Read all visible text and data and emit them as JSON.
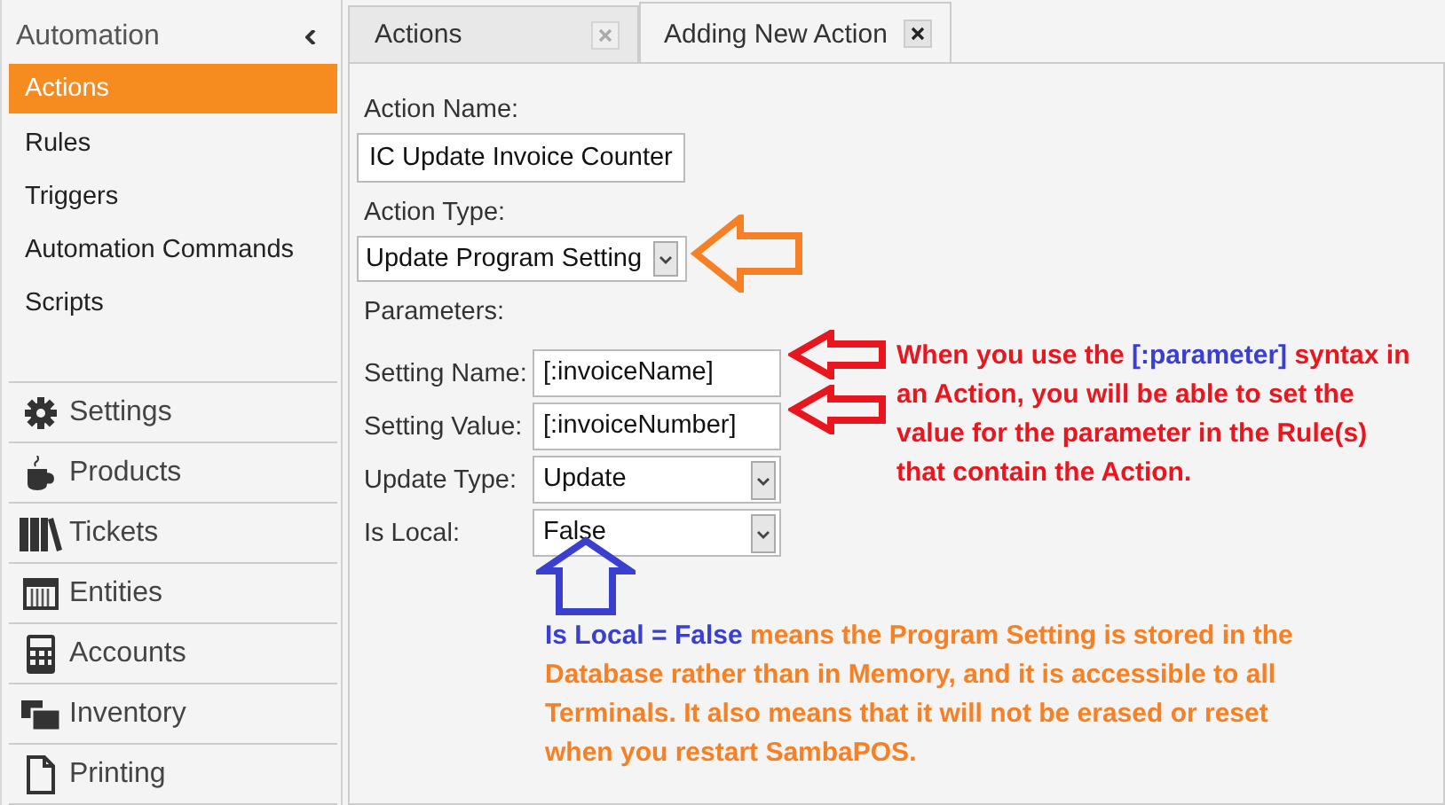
{
  "sidebar": {
    "title": "Automation",
    "items": [
      {
        "label": "Actions",
        "selected": true
      },
      {
        "label": "Rules",
        "selected": false
      },
      {
        "label": "Triggers",
        "selected": false
      },
      {
        "label": "Automation Commands",
        "selected": false
      },
      {
        "label": "Scripts",
        "selected": false
      }
    ],
    "modules": [
      {
        "label": "Settings",
        "kind": "gear"
      },
      {
        "label": "Products",
        "kind": "cup"
      },
      {
        "label": "Tickets",
        "kind": "books"
      },
      {
        "label": "Entities",
        "kind": "grid"
      },
      {
        "label": "Accounts",
        "kind": "calculator"
      },
      {
        "label": "Inventory",
        "kind": "stack"
      },
      {
        "label": "Printing",
        "kind": "page"
      }
    ]
  },
  "tabs": [
    {
      "label": "Actions",
      "selected": false
    },
    {
      "label": "Adding New Action",
      "selected": true
    }
  ],
  "form": {
    "action_name_label": "Action Name:",
    "action_name": "IC Update Invoice Counter",
    "action_type_label": "Action Type:",
    "action_type": "Update Program Setting",
    "parameters_label": "Parameters:",
    "parameters": [
      {
        "label": "Setting Name:",
        "value": "[:invoiceName]",
        "kind": "text"
      },
      {
        "label": "Setting Value:",
        "value": "[:invoiceNumber]",
        "kind": "text"
      },
      {
        "label": "Update Type:",
        "value": "Update",
        "kind": "dropdown"
      },
      {
        "label": "Is Local:",
        "value": "False",
        "kind": "dropdown"
      }
    ]
  },
  "annotations": [
    {
      "kind": "red",
      "segments": [
        {
          "text": "When you use the ",
          "emphasis": false
        },
        {
          "text": "[:parameter]",
          "emphasis": true
        },
        {
          "text": " syntax in an Action, you will be able to set the value for the parameter in the Rule(s) that contain the Action.",
          "emphasis": false
        }
      ]
    },
    {
      "kind": "orange",
      "segments": [
        {
          "text": "Is Local = False",
          "emphasis": true
        },
        {
          "text": " means the Program Setting is stored in the Database rather than in Memory,  and it is accessible to all Terminals.  It also means that it will not be erased or reset when you restart SambaPOS.",
          "emphasis": false
        }
      ]
    }
  ]
}
